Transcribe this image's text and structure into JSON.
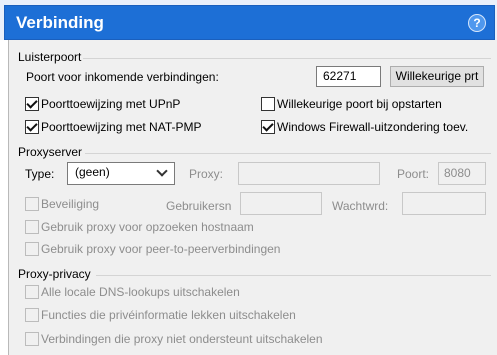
{
  "header": {
    "title": "Verbinding",
    "help_icon": "?"
  },
  "listen_port": {
    "section_title": "Luisterpoort",
    "incoming_label": "Poort voor inkomende verbindingen:",
    "port_value": "62271",
    "random_button": "Willekeurige prt",
    "options": [
      {
        "label": "Poorttoewijzing met UPnP",
        "checked": true
      },
      {
        "label": "Willekeurige poort bij opstarten",
        "checked": false
      },
      {
        "label": "Poorttoewijzing met NAT-PMP",
        "checked": true
      },
      {
        "label": "Windows Firewall-uitzondering toev.",
        "checked": true
      }
    ]
  },
  "proxy_server": {
    "section_title": "Proxyserver",
    "type_label": "Type:",
    "type_value": "(geen)",
    "proxy_label": "Proxy:",
    "port_label": "Poort:",
    "port_value": "8080",
    "auth_label": "Beveiliging",
    "username_label": "Gebruikersn",
    "password_label": "Wachtwrd:",
    "options": [
      {
        "label": "Gebruik proxy voor opzoeken hostnaam",
        "checked": false
      },
      {
        "label": "Gebruik proxy voor peer-to-peerverbindingen",
        "checked": false
      }
    ]
  },
  "proxy_privacy": {
    "section_title": "Proxy-privacy",
    "options": [
      {
        "label": "Alle locale DNS-lookups uitschakelen",
        "checked": false
      },
      {
        "label": "Functies die privéinformatie lekken uitschakelen",
        "checked": false
      },
      {
        "label": "Verbindingen die proxy niet ondersteunt uitschakelen",
        "checked": false
      }
    ]
  }
}
